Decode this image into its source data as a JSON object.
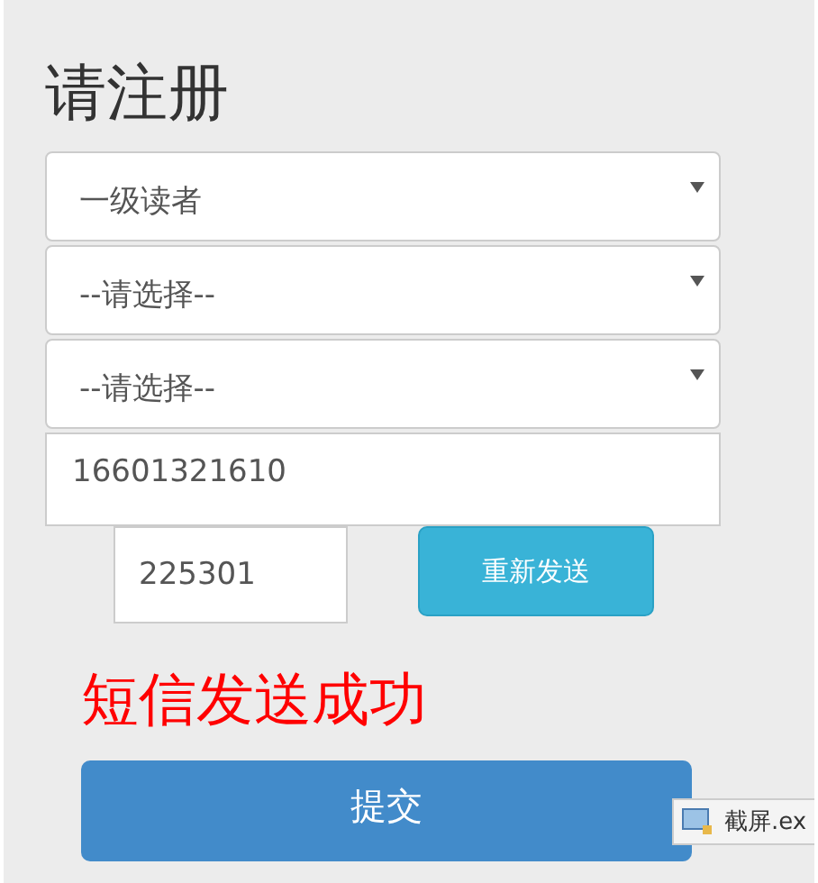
{
  "title": "请注册",
  "selects": [
    {
      "value": "一级读者"
    },
    {
      "value": "--请选择--"
    },
    {
      "value": "--请选择--"
    }
  ],
  "phone": {
    "value": "16601321610"
  },
  "code": {
    "value": "225301"
  },
  "resend_button": "重新发送",
  "message": "短信发送成功",
  "submit_button": "提交",
  "taskbar_tooltip": {
    "label": "截屏.ex"
  }
}
